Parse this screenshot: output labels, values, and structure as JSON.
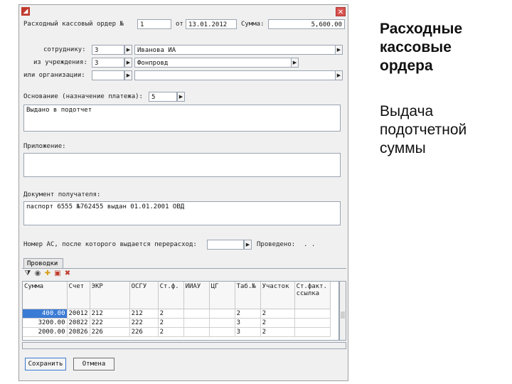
{
  "form": {
    "row_header": {
      "label": "Расходный кассовый ордер №",
      "number": "1",
      "date_label": "от",
      "date": "13.01.2012",
      "amount_label": "Сумма:",
      "amount": "5,600.00"
    },
    "employee": {
      "label": "сотруднику:",
      "code": "3",
      "value": "Иванова ИА"
    },
    "institution": {
      "label": "из учреждения:",
      "code": "3",
      "value": "Фонпровд"
    },
    "organization": {
      "label": "или организации:",
      "code": "",
      "value": ""
    },
    "basis": {
      "label": "Основание (назначение платежа):",
      "code": "5",
      "text": "Выдано в подотчет"
    },
    "appendix": {
      "label": "Приложение:",
      "text": ""
    },
    "document": {
      "label": "Документ получателя:",
      "text": "паспорт 6555 №762455 выдан 01.01.2001 ОВД"
    },
    "footer_row": {
      "label": "Номер АС, после которого выдается перерасход:",
      "posted_label": "Проведено:",
      "posted_value": ". ."
    }
  },
  "tabs": [
    {
      "label": "Проводки"
    }
  ],
  "grid": {
    "headers": [
      "Сумма",
      "Счет",
      "ЭКР",
      "ОСГУ",
      "Ст.ф.",
      "ИИАУ",
      "ЦГ",
      "Таб.№",
      "Участок",
      "Ст.факт. ссылка"
    ],
    "rows": [
      [
        "400.00",
        "20012",
        "212",
        "212",
        "2",
        "",
        "",
        "2",
        "2 ",
        " "
      ],
      [
        "3200.00",
        "20822",
        "222",
        "222",
        "2",
        "",
        "",
        "3",
        "2 ",
        " "
      ],
      [
        "2000.00",
        "20826",
        "226",
        "226",
        "2",
        "",
        "",
        "3",
        "2 ",
        " "
      ]
    ]
  },
  "buttons": {
    "save": "Сохранить",
    "cancel": "Отмена"
  },
  "side": {
    "title": "Расходные кассовые ордера",
    "subtitle": "Выдача подотчетной суммы"
  },
  "icons": {
    "app": "app-icon",
    "close": "close-icon"
  }
}
